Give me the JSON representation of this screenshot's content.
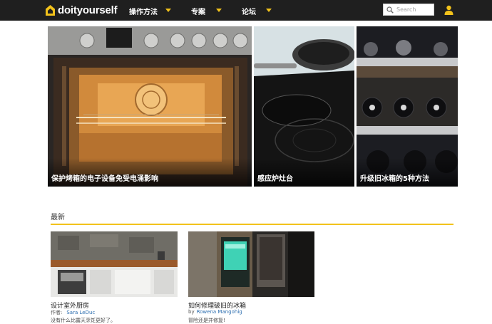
{
  "site": {
    "logo_text": "doityourself"
  },
  "nav": {
    "items": [
      {
        "label": "操作方法"
      },
      {
        "label": "专案"
      },
      {
        "label": "论坛"
      }
    ]
  },
  "search": {
    "placeholder": "Search"
  },
  "hero": {
    "tiles": [
      {
        "caption": "保护烤箱的电子设备免受电涌影响"
      },
      {
        "caption": "感应炉灶台"
      },
      {
        "caption": "升级旧冰箱的5种方法"
      }
    ]
  },
  "latest": {
    "heading": "最新",
    "accent_color": "#f2c21b",
    "cards": [
      {
        "title": "设计室外厨房",
        "byline_prefix": "作者:",
        "author": "Sara LeDuc",
        "description": "没有什么比露天烹饪更好了。"
      },
      {
        "title": "如何修理破旧的冰箱",
        "byline_prefix": "by",
        "author": "Rowena Mangohig",
        "description": "冒险还是并修复!"
      }
    ]
  },
  "colors": {
    "nav_bg": "#1f1f1f",
    "accent": "#f2c21b",
    "link": "#2e6fb0"
  }
}
